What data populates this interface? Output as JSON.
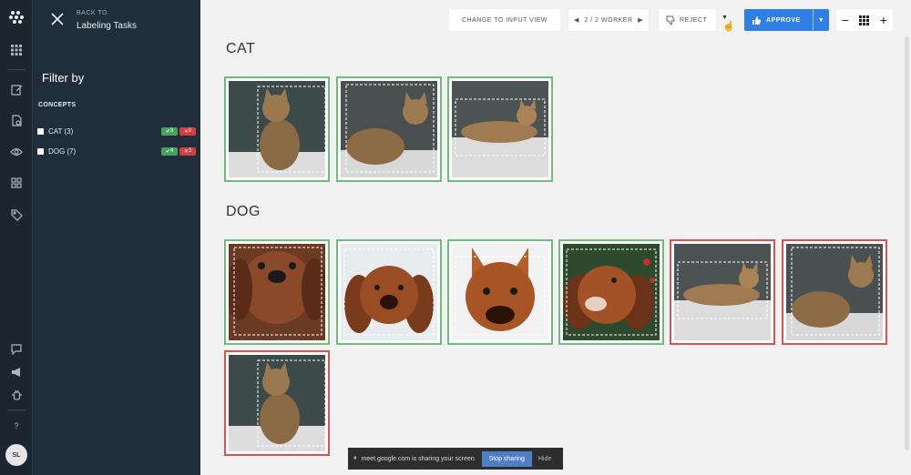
{
  "panel": {
    "back_small": "BACK TO",
    "back_title": "Labeling Tasks",
    "filter_title": "Filter by",
    "concepts_label": "CONCEPTS",
    "concepts": [
      {
        "label": "CAT (3)",
        "approved": "3",
        "rejected": "0"
      },
      {
        "label": "DOG (7)",
        "approved": "4",
        "rejected": "3"
      }
    ]
  },
  "rail": {
    "icons": [
      "grid-icon",
      "edit-icon",
      "document-icon",
      "eye-icon",
      "modules-icon",
      "tag-icon",
      "chat-icon",
      "megaphone-icon",
      "bug-icon",
      "help-icon"
    ],
    "help_glyph": "?",
    "avatar": "SL"
  },
  "toolbar": {
    "change_view": "CHANGE TO INPUT VIEW",
    "worker": "2 / 2 WORKER",
    "reject": "REJECT",
    "approve": "APPROVE",
    "zoom_out": "−",
    "zoom_in": "+"
  },
  "sections": [
    {
      "title": "CAT",
      "images": [
        {
          "subject": "cat",
          "status": "approved"
        },
        {
          "subject": "cat",
          "status": "approved"
        },
        {
          "subject": "cat",
          "status": "approved"
        }
      ]
    },
    {
      "title": "DOG",
      "images": [
        {
          "subject": "dog",
          "status": "approved"
        },
        {
          "subject": "dog",
          "status": "approved"
        },
        {
          "subject": "dog",
          "status": "approved"
        },
        {
          "subject": "dog",
          "status": "approved"
        },
        {
          "subject": "cat",
          "status": "rejected"
        },
        {
          "subject": "cat",
          "status": "rejected"
        },
        {
          "subject": "cat",
          "status": "rejected"
        }
      ]
    }
  ],
  "share_bar": {
    "message": "meet.google.com is sharing your screen.",
    "stop": "Stop sharing",
    "hide": "Hide"
  },
  "colors": {
    "approved": "#6cbf7b",
    "rejected": "#d9534f",
    "accent": "#2f7fe6",
    "sidebar": "#202d3a"
  }
}
